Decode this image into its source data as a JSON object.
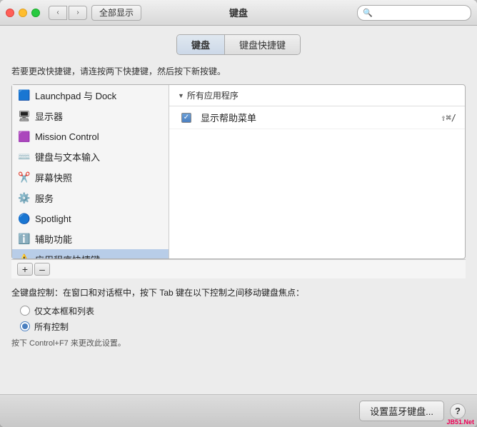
{
  "window": {
    "title": "键盘"
  },
  "titlebar": {
    "show_all_label": "全部显示",
    "search_placeholder": ""
  },
  "tabs": [
    {
      "id": "keyboard",
      "label": "键盘",
      "active": true
    },
    {
      "id": "shortcuts",
      "label": "键盘快捷键",
      "active": false
    }
  ],
  "description": "若要更改快捷键，请连按两下快捷键，然后按下新按键。",
  "left_list": [
    {
      "id": "launchpad",
      "label": "Launchpad 与 Dock",
      "icon": "🟦",
      "active": false
    },
    {
      "id": "display",
      "label": "显示器",
      "icon": "🖥",
      "active": false
    },
    {
      "id": "mission",
      "label": "Mission Control",
      "icon": "🟪",
      "active": false
    },
    {
      "id": "keyboard_input",
      "label": "键盘与文本输入",
      "icon": "⌨️",
      "active": false
    },
    {
      "id": "screenshot",
      "label": "屏幕快照",
      "icon": "✂️",
      "active": false
    },
    {
      "id": "services",
      "label": "服务",
      "icon": "⚙️",
      "active": false
    },
    {
      "id": "spotlight",
      "label": "Spotlight",
      "icon": "🔵",
      "active": false
    },
    {
      "id": "accessibility",
      "label": "辅助功能",
      "icon": "ℹ️",
      "active": false
    },
    {
      "id": "app_shortcuts",
      "label": "应用程序快捷键",
      "icon": "⚠️",
      "active": true
    }
  ],
  "right_panel": {
    "header": "所有应用程序",
    "rows": [
      {
        "checked": true,
        "label": "显示帮助菜单",
        "shortcut": "⇧⌘/"
      }
    ]
  },
  "add_remove": {
    "add_label": "+",
    "remove_label": "–"
  },
  "bottom": {
    "full_keyboard_label": "全键盘控制：在窗口和对话框中，按下 Tab 键在以下控制之间移动键盘焦点：",
    "radio_options": [
      {
        "id": "text_only",
        "label": "仅文本框和列表",
        "checked": false
      },
      {
        "id": "all_controls",
        "label": "所有控制",
        "checked": true
      }
    ],
    "hint": "按下 Control+F7 来更改此设置。"
  },
  "footer": {
    "bluetooth_btn": "设置蓝牙键盘...",
    "help_label": "?"
  },
  "watermark": "JB51.Net"
}
